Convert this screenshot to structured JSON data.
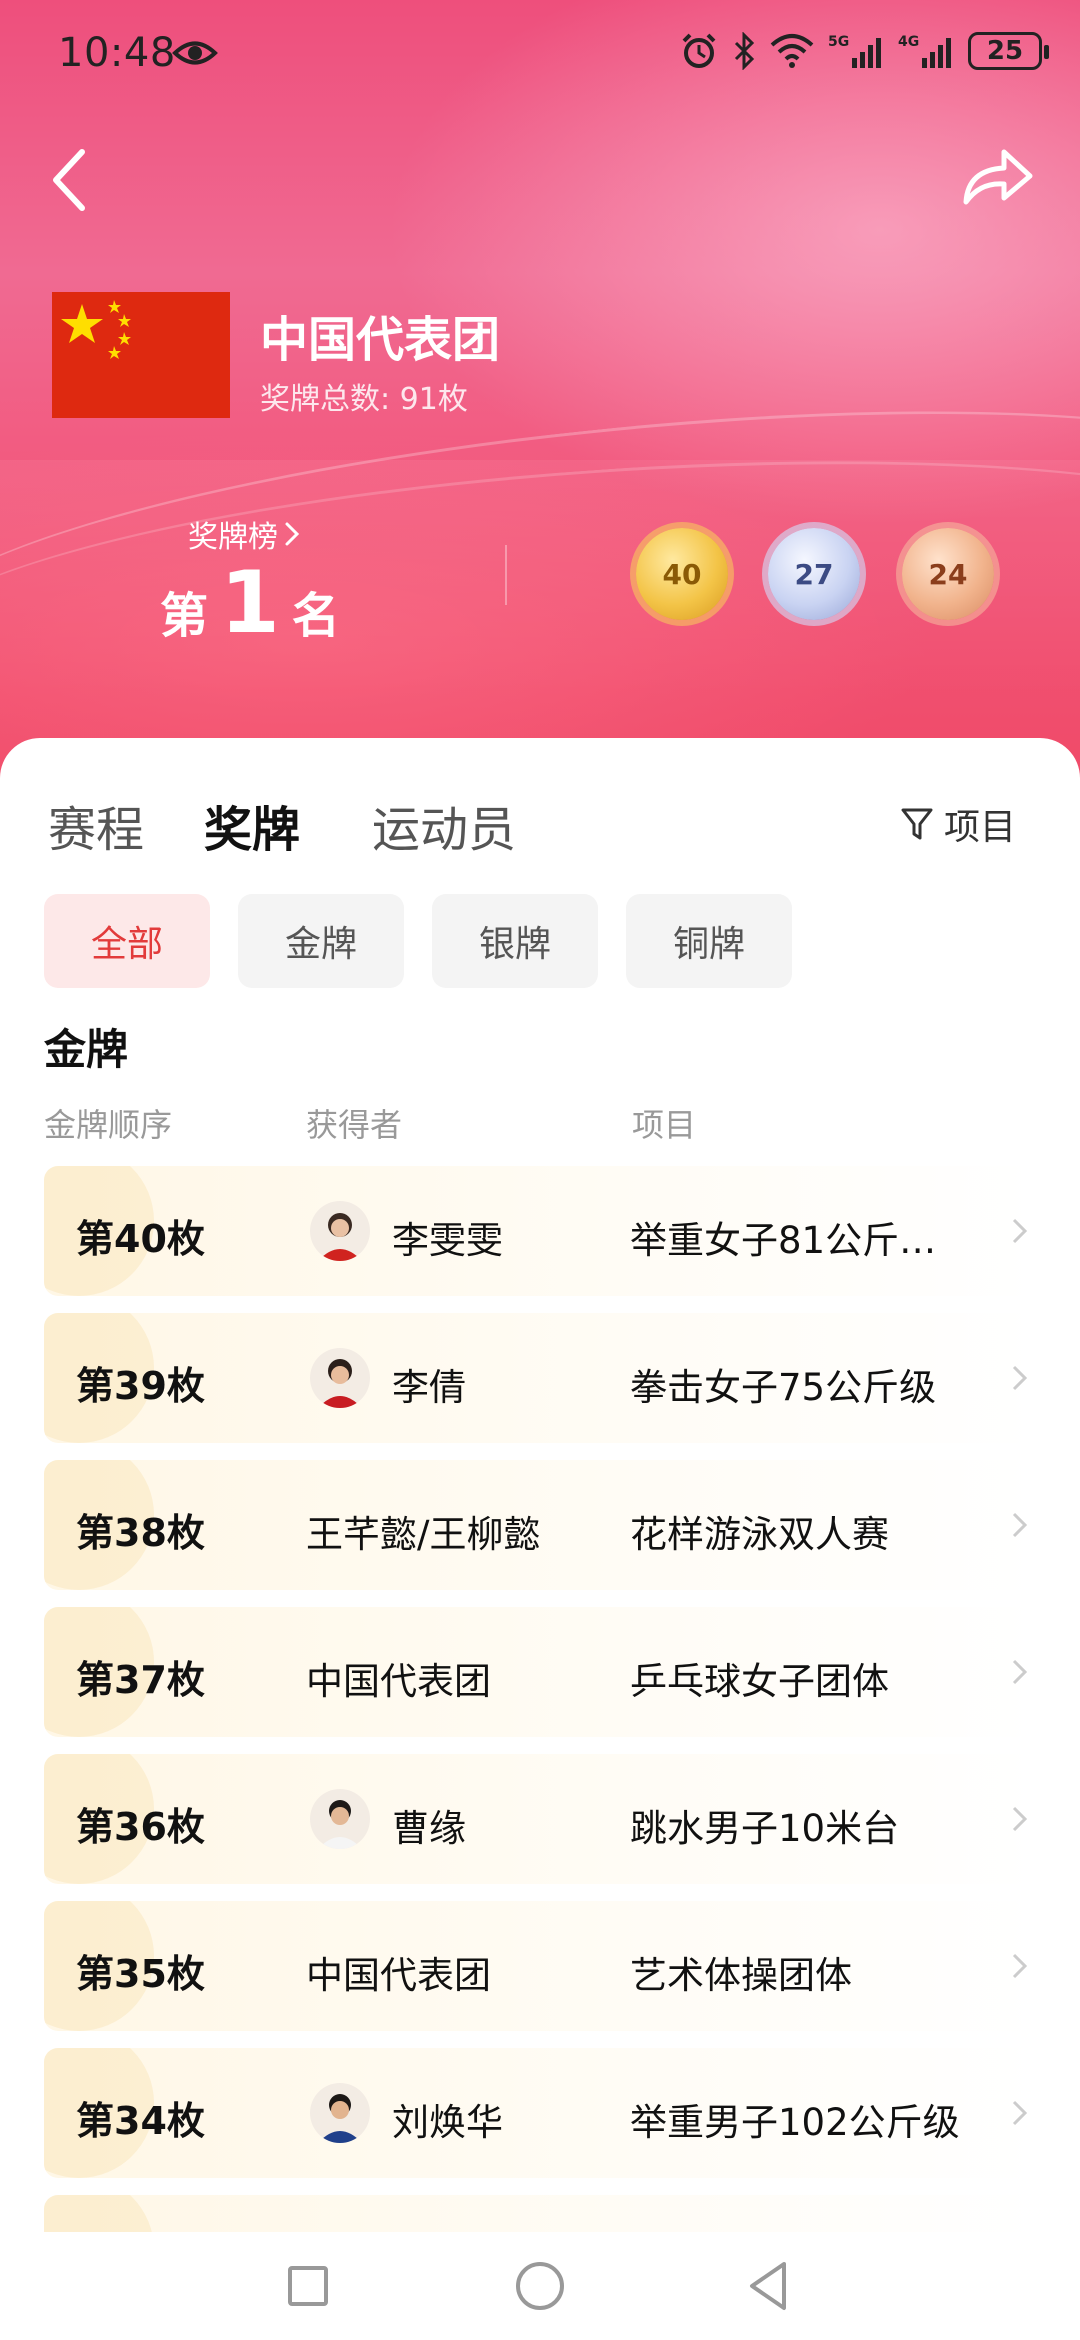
{
  "status_bar": {
    "time": "10:48",
    "battery": "25",
    "icons": [
      "eye-icon",
      "alarm-icon",
      "bluetooth-icon",
      "wifi-icon",
      "5g-signal-icon",
      "4g-signal-icon",
      "battery-icon"
    ]
  },
  "header": {
    "back_icon": "chevron-left-icon",
    "share_icon": "share-icon",
    "team_name": "中国代表团",
    "total_label": "奖牌总数: 91枚",
    "rank_label": "奖牌榜",
    "rank_prefix": "第",
    "rank_number": "1",
    "rank_suffix": "名",
    "medals": {
      "gold": "40",
      "silver": "27",
      "bronze": "24"
    }
  },
  "tabs": [
    {
      "label": "赛程"
    },
    {
      "label": "奖牌"
    },
    {
      "label": "运动员"
    }
  ],
  "filter_label": "项目",
  "chips": [
    {
      "label": "全部"
    },
    {
      "label": "金牌"
    },
    {
      "label": "银牌"
    },
    {
      "label": "铜牌"
    }
  ],
  "section_title": "金牌",
  "columns": {
    "order": "金牌顺序",
    "winner": "获得者",
    "event": "项目"
  },
  "rows": [
    {
      "rank": "第40枚",
      "winner": "李雯雯",
      "event": "举重女子81公斤…",
      "has_avatar": true
    },
    {
      "rank": "第39枚",
      "winner": "李倩",
      "event": "拳击女子75公斤级",
      "has_avatar": true
    },
    {
      "rank": "第38枚",
      "winner": "王芊懿/王柳懿",
      "event": "花样游泳双人赛",
      "has_avatar": false
    },
    {
      "rank": "第37枚",
      "winner": "中国代表团",
      "event": "乒乓球女子团体",
      "has_avatar": false
    },
    {
      "rank": "第36枚",
      "winner": "曹缘",
      "event": "跳水男子10米台",
      "has_avatar": true
    },
    {
      "rank": "第35枚",
      "winner": "中国代表团",
      "event": "艺术体操团体",
      "has_avatar": false
    },
    {
      "rank": "第34枚",
      "winner": "刘焕华",
      "event": "举重男子102公斤级",
      "has_avatar": true
    }
  ],
  "colors": {
    "accent": "#e23b3b",
    "header_pink": "#ee4f7c",
    "gold": "#f3c447",
    "silver": "#c9d3f2",
    "bronze": "#f1b38c"
  }
}
